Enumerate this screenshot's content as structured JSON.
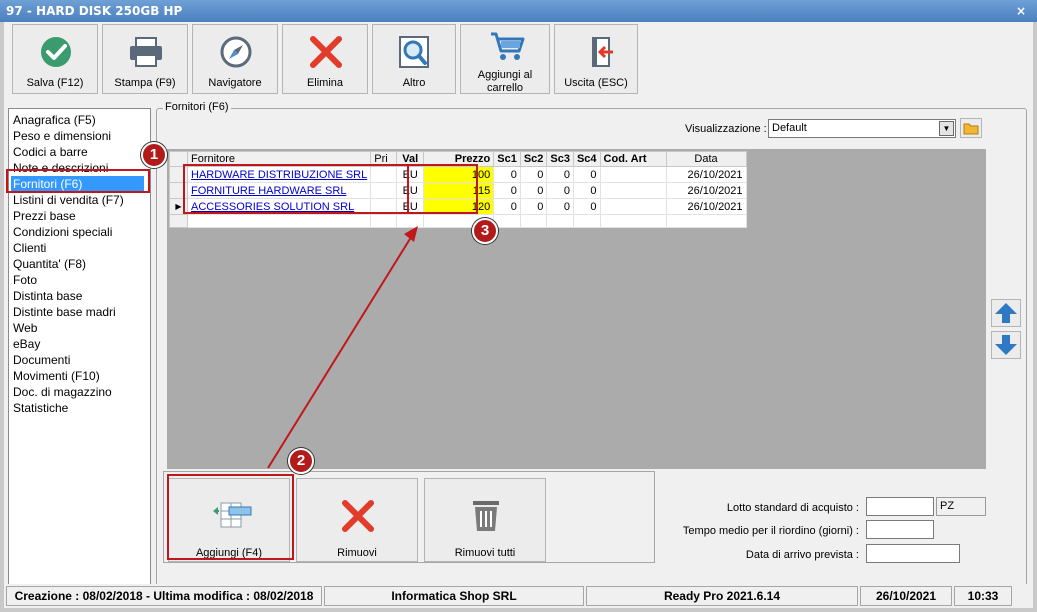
{
  "window": {
    "title": "97 - HARD DISK 250GB HP",
    "close_glyph": "×"
  },
  "toolbar": [
    {
      "id": "salva",
      "label": "Salva (F12)",
      "icon": "check-icon"
    },
    {
      "id": "stampa",
      "label": "Stampa (F9)",
      "icon": "printer-icon"
    },
    {
      "id": "navigatore",
      "label": "Navigatore",
      "icon": "compass-icon"
    },
    {
      "id": "elimina",
      "label": "Elimina",
      "icon": "delete-x-icon"
    },
    {
      "id": "altro",
      "label": "Altro",
      "icon": "magnifier-icon"
    },
    {
      "id": "carrello",
      "label_line1": "Aggiungi al",
      "label_line2": "carrello",
      "icon": "cart-icon"
    },
    {
      "id": "uscita",
      "label": "Uscita (ESC)",
      "icon": "exit-icon"
    }
  ],
  "nav": {
    "items": [
      "Anagrafica (F5)",
      "Peso e dimensioni",
      "Codici a barre",
      "Note e descrizioni",
      "Fornitori (F6)",
      "Listini di vendita (F7)",
      "Prezzi base",
      "Condizioni speciali",
      "Clienti",
      "Quantita' (F8)",
      "Foto",
      "Distinta base",
      "Distinte base madri",
      "Web",
      "eBay",
      "Documenti",
      "Movimenti (F10)",
      "Doc. di magazzino",
      "Statistiche"
    ],
    "selected_index": 4
  },
  "group": {
    "title": "Fornitori (F6)"
  },
  "visualizzazione": {
    "label": "Visualizzazione :",
    "value": "Default"
  },
  "grid": {
    "columns": [
      "Fornitore",
      "Pri",
      "Val",
      "Prezzo",
      "Sc1",
      "Sc2",
      "Sc3",
      "Sc4",
      "Cod. Art",
      "Data"
    ],
    "rows": [
      {
        "fornitore": "HARDWARE DISTRIBUZIONE SRL",
        "pri": "",
        "val": "EU",
        "prezzo": "100",
        "sc1": "0",
        "sc2": "0",
        "sc3": "0",
        "sc4": "0",
        "cod_art": "",
        "data": "26/10/2021",
        "current": false
      },
      {
        "fornitore": "FORNITURE HARDWARE SRL",
        "pri": "",
        "val": "EU",
        "prezzo": "115",
        "sc1": "0",
        "sc2": "0",
        "sc3": "0",
        "sc4": "0",
        "cod_art": "",
        "data": "26/10/2021",
        "current": false
      },
      {
        "fornitore": "ACCESSORIES SOLUTION SRL",
        "pri": "",
        "val": "EU",
        "prezzo": "120",
        "sc1": "0",
        "sc2": "0",
        "sc3": "0",
        "sc4": "0",
        "cod_art": "",
        "data": "26/10/2021",
        "current": true
      }
    ],
    "row_indicator": "▶"
  },
  "buttons": {
    "aggiungi": "Aggiungi (F4)",
    "rimuovi": "Rimuovi",
    "rimuovi_tutti": "Rimuovi tutti"
  },
  "fields": {
    "lotto_label": "Lotto standard di acquisto :",
    "lotto_value": "",
    "lotto_unit": "PZ",
    "tempo_label": "Tempo medio per il riordino (giorni) :",
    "tempo_value": "",
    "arrivo_label": "Data di arrivo prevista :",
    "arrivo_value": ""
  },
  "status": {
    "creazione": "Creazione : 08/02/2018 - Ultima modifica : 08/02/2018",
    "company": "Informatica Shop SRL",
    "version": "Ready Pro 2021.6.14",
    "date": "26/10/2021",
    "time": "10:33"
  },
  "annotations": [
    "1",
    "2",
    "3"
  ],
  "colors": {
    "annotation_red": "#c0171c",
    "highlight_yellow": "#ffff00",
    "selection_blue": "#3399ff"
  }
}
